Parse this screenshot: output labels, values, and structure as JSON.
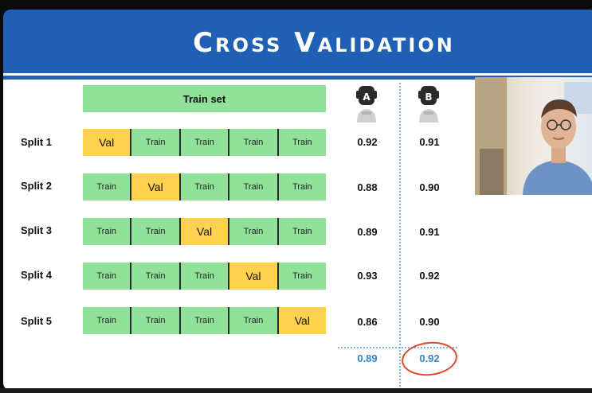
{
  "slide": {
    "title": "Cross Validation",
    "header_cell": "Train set",
    "models": [
      {
        "letter": "A"
      },
      {
        "letter": "B"
      }
    ],
    "splits": [
      {
        "label": "Split 1",
        "cells": [
          "Val",
          "Train",
          "Train",
          "Train",
          "Train"
        ],
        "score_a": "0.92",
        "score_b": "0.91"
      },
      {
        "label": "Split 2",
        "cells": [
          "Train",
          "Val",
          "Train",
          "Train",
          "Train"
        ],
        "score_a": "0.88",
        "score_b": "0.90"
      },
      {
        "label": "Split 3",
        "cells": [
          "Train",
          "Train",
          "Val",
          "Train",
          "Train"
        ],
        "score_a": "0.89",
        "score_b": "0.91"
      },
      {
        "label": "Split 4",
        "cells": [
          "Train",
          "Train",
          "Train",
          "Val",
          "Train"
        ],
        "score_a": "0.93",
        "score_b": "0.92"
      },
      {
        "label": "Split 5",
        "cells": [
          "Train",
          "Train",
          "Train",
          "Train",
          "Val"
        ],
        "score_a": "0.86",
        "score_b": "0.90"
      }
    ],
    "averages": {
      "a": "0.89",
      "b": "0.92"
    }
  },
  "colors": {
    "banner": "#1f5fb4",
    "train": "#90e29a",
    "val": "#ffd24d",
    "average": "#2f86cf",
    "highlight_circle": "#e04a2a"
  },
  "icons": [
    "robot-a-icon",
    "robot-b-icon"
  ]
}
